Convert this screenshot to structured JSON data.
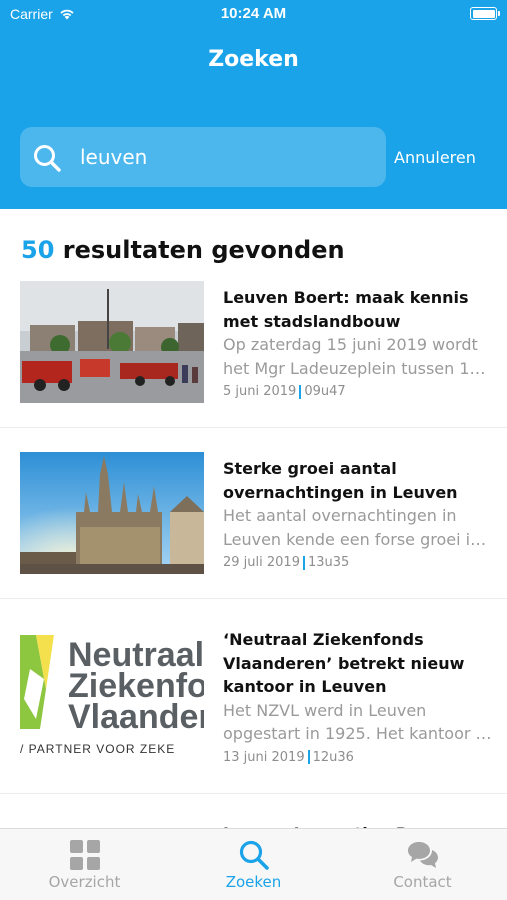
{
  "status_bar": {
    "carrier": "Carrier",
    "time": "10:24 AM"
  },
  "header": {
    "title": "Zoeken"
  },
  "search": {
    "value": "leuven",
    "cancel_label": "Annuleren"
  },
  "results": {
    "count": "50",
    "label": " resultaten gevonden"
  },
  "items": [
    {
      "title": "Leuven Boert: maak kennis met stadslandbouw",
      "excerpt": "Op zaterdag 15 juni 2019 wordt het Mgr Ladeuzeplein tussen 1…",
      "date": "5 juni 2019",
      "time": "09u47"
    },
    {
      "title": "Sterke groei aantal overnachtingen in Leuven",
      "excerpt": "Het aantal overnachtingen in Leuven kende een forse groei i…",
      "date": "29 juli 2019",
      "time": "13u35"
    },
    {
      "title": "‘Neutraal Ziekenfonds Vlaanderen’ betrekt nieuw kantoor in Leuven",
      "excerpt": "Het NZVL werd in Leuven opgestart in 1925. Het kantoor …",
      "date": "13 juni 2019",
      "time": "12u36",
      "logo_lines": [
        "Neutraal",
        "Ziekenfon",
        "Vlaander"
      ],
      "logo_tagline": "/ PARTNER VOOR ZEKE"
    }
  ],
  "peek_item": {
    "title": "Leuven Innovation B"
  },
  "tabs": [
    {
      "label": "Overzicht",
      "icon": "grid-icon",
      "active": false
    },
    {
      "label": "Zoeken",
      "icon": "search-icon",
      "active": true
    },
    {
      "label": "Contact",
      "icon": "chat-bubbles-icon",
      "active": false
    }
  ],
  "colors": {
    "accent": "#1aa3e8",
    "header_bg": "#1aa3e8",
    "logo_green": "#8dc63f",
    "logo_gray": "#5a5f63"
  }
}
